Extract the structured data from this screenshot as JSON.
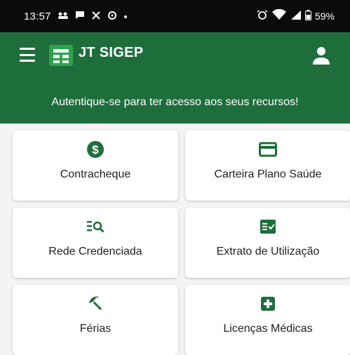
{
  "status_bar": {
    "time": "13:57",
    "battery": "59%"
  },
  "app_bar": {
    "title": "JT SIGEP"
  },
  "banner": {
    "message": "Autentique-se para ter acesso aos seus recursos!"
  },
  "cards": [
    {
      "label": "Contracheque",
      "icon": "dollar-circle-icon"
    },
    {
      "label": "Carteira Plano Saúde",
      "icon": "card-icon"
    },
    {
      "label": "Rede Credenciada",
      "icon": "list-search-icon"
    },
    {
      "label": "Extrato de Utilização",
      "icon": "statement-icon"
    },
    {
      "label": "Férias",
      "icon": "beach-umbrella-icon"
    },
    {
      "label": "Licenças Médicas",
      "icon": "medical-cross-icon"
    }
  ],
  "colors": {
    "brand_green": "#1e6e3c",
    "logo_green": "#2fa14f",
    "status_bar": "#0b0b0b",
    "background": "#f4f4f4"
  }
}
